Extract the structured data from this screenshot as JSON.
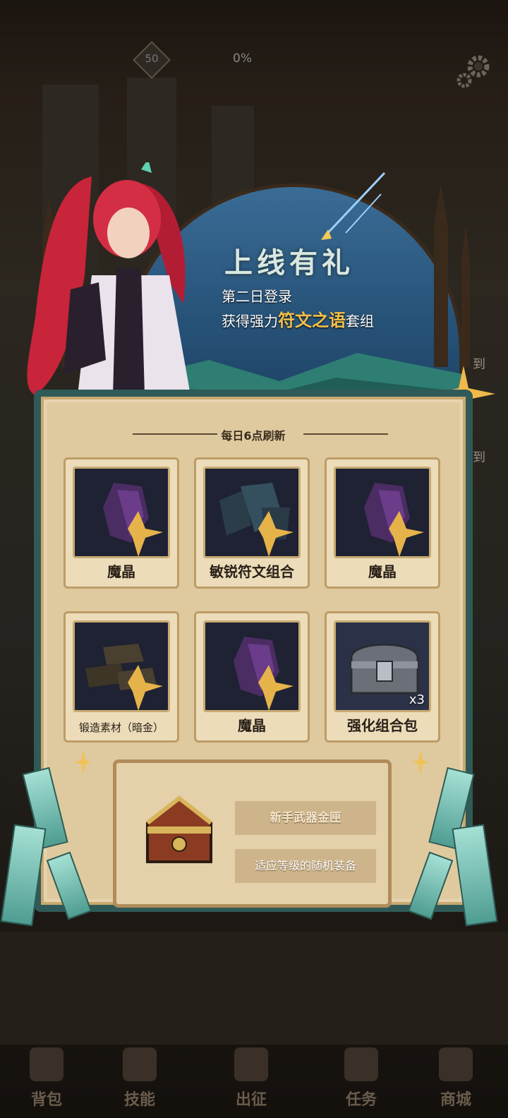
{
  "hud": {
    "level": "50",
    "progress": "0%"
  },
  "popup": {
    "title": "上线有礼",
    "subtitle_line1": "第二日登录",
    "subtitle_prefix": "获得强力",
    "subtitle_highlight": "符文之语",
    "subtitle_suffix": "套组",
    "refresh_text": "每日6点刷新",
    "items": [
      {
        "name": "魔晶",
        "icon": "purple-crystal-icon",
        "count": ""
      },
      {
        "name": "敏锐符文组合",
        "icon": "rune-stones-icon",
        "count": ""
      },
      {
        "name": "魔晶",
        "icon": "purple-crystal-icon",
        "count": ""
      },
      {
        "name": "锻造素材（暗金）",
        "icon": "dark-gold-ingots-icon",
        "count": ""
      },
      {
        "name": "魔晶",
        "icon": "purple-crystal-icon",
        "count": ""
      },
      {
        "name": "强化组合包",
        "icon": "silver-chest-icon",
        "count": "x3"
      }
    ],
    "reward": {
      "name": "新手武器金匣",
      "desc": "适应等级的随机装备",
      "icon": "golden-chest-icon"
    }
  },
  "side_tags": [
    "到",
    "到"
  ],
  "nav": [
    {
      "label": "背包",
      "icon": "bag-icon"
    },
    {
      "label": "技能",
      "icon": "skill-book-icon"
    },
    {
      "label": "出征",
      "icon": "sword-icon"
    },
    {
      "label": "任务",
      "icon": "scroll-icon"
    },
    {
      "label": "商城",
      "icon": "shop-icon"
    }
  ],
  "colors": {
    "teal_frame": "#2f5a58",
    "parchment": "#e6d3ae",
    "highlight": "#f3c04a",
    "arch_sky": "#3a6c95"
  }
}
